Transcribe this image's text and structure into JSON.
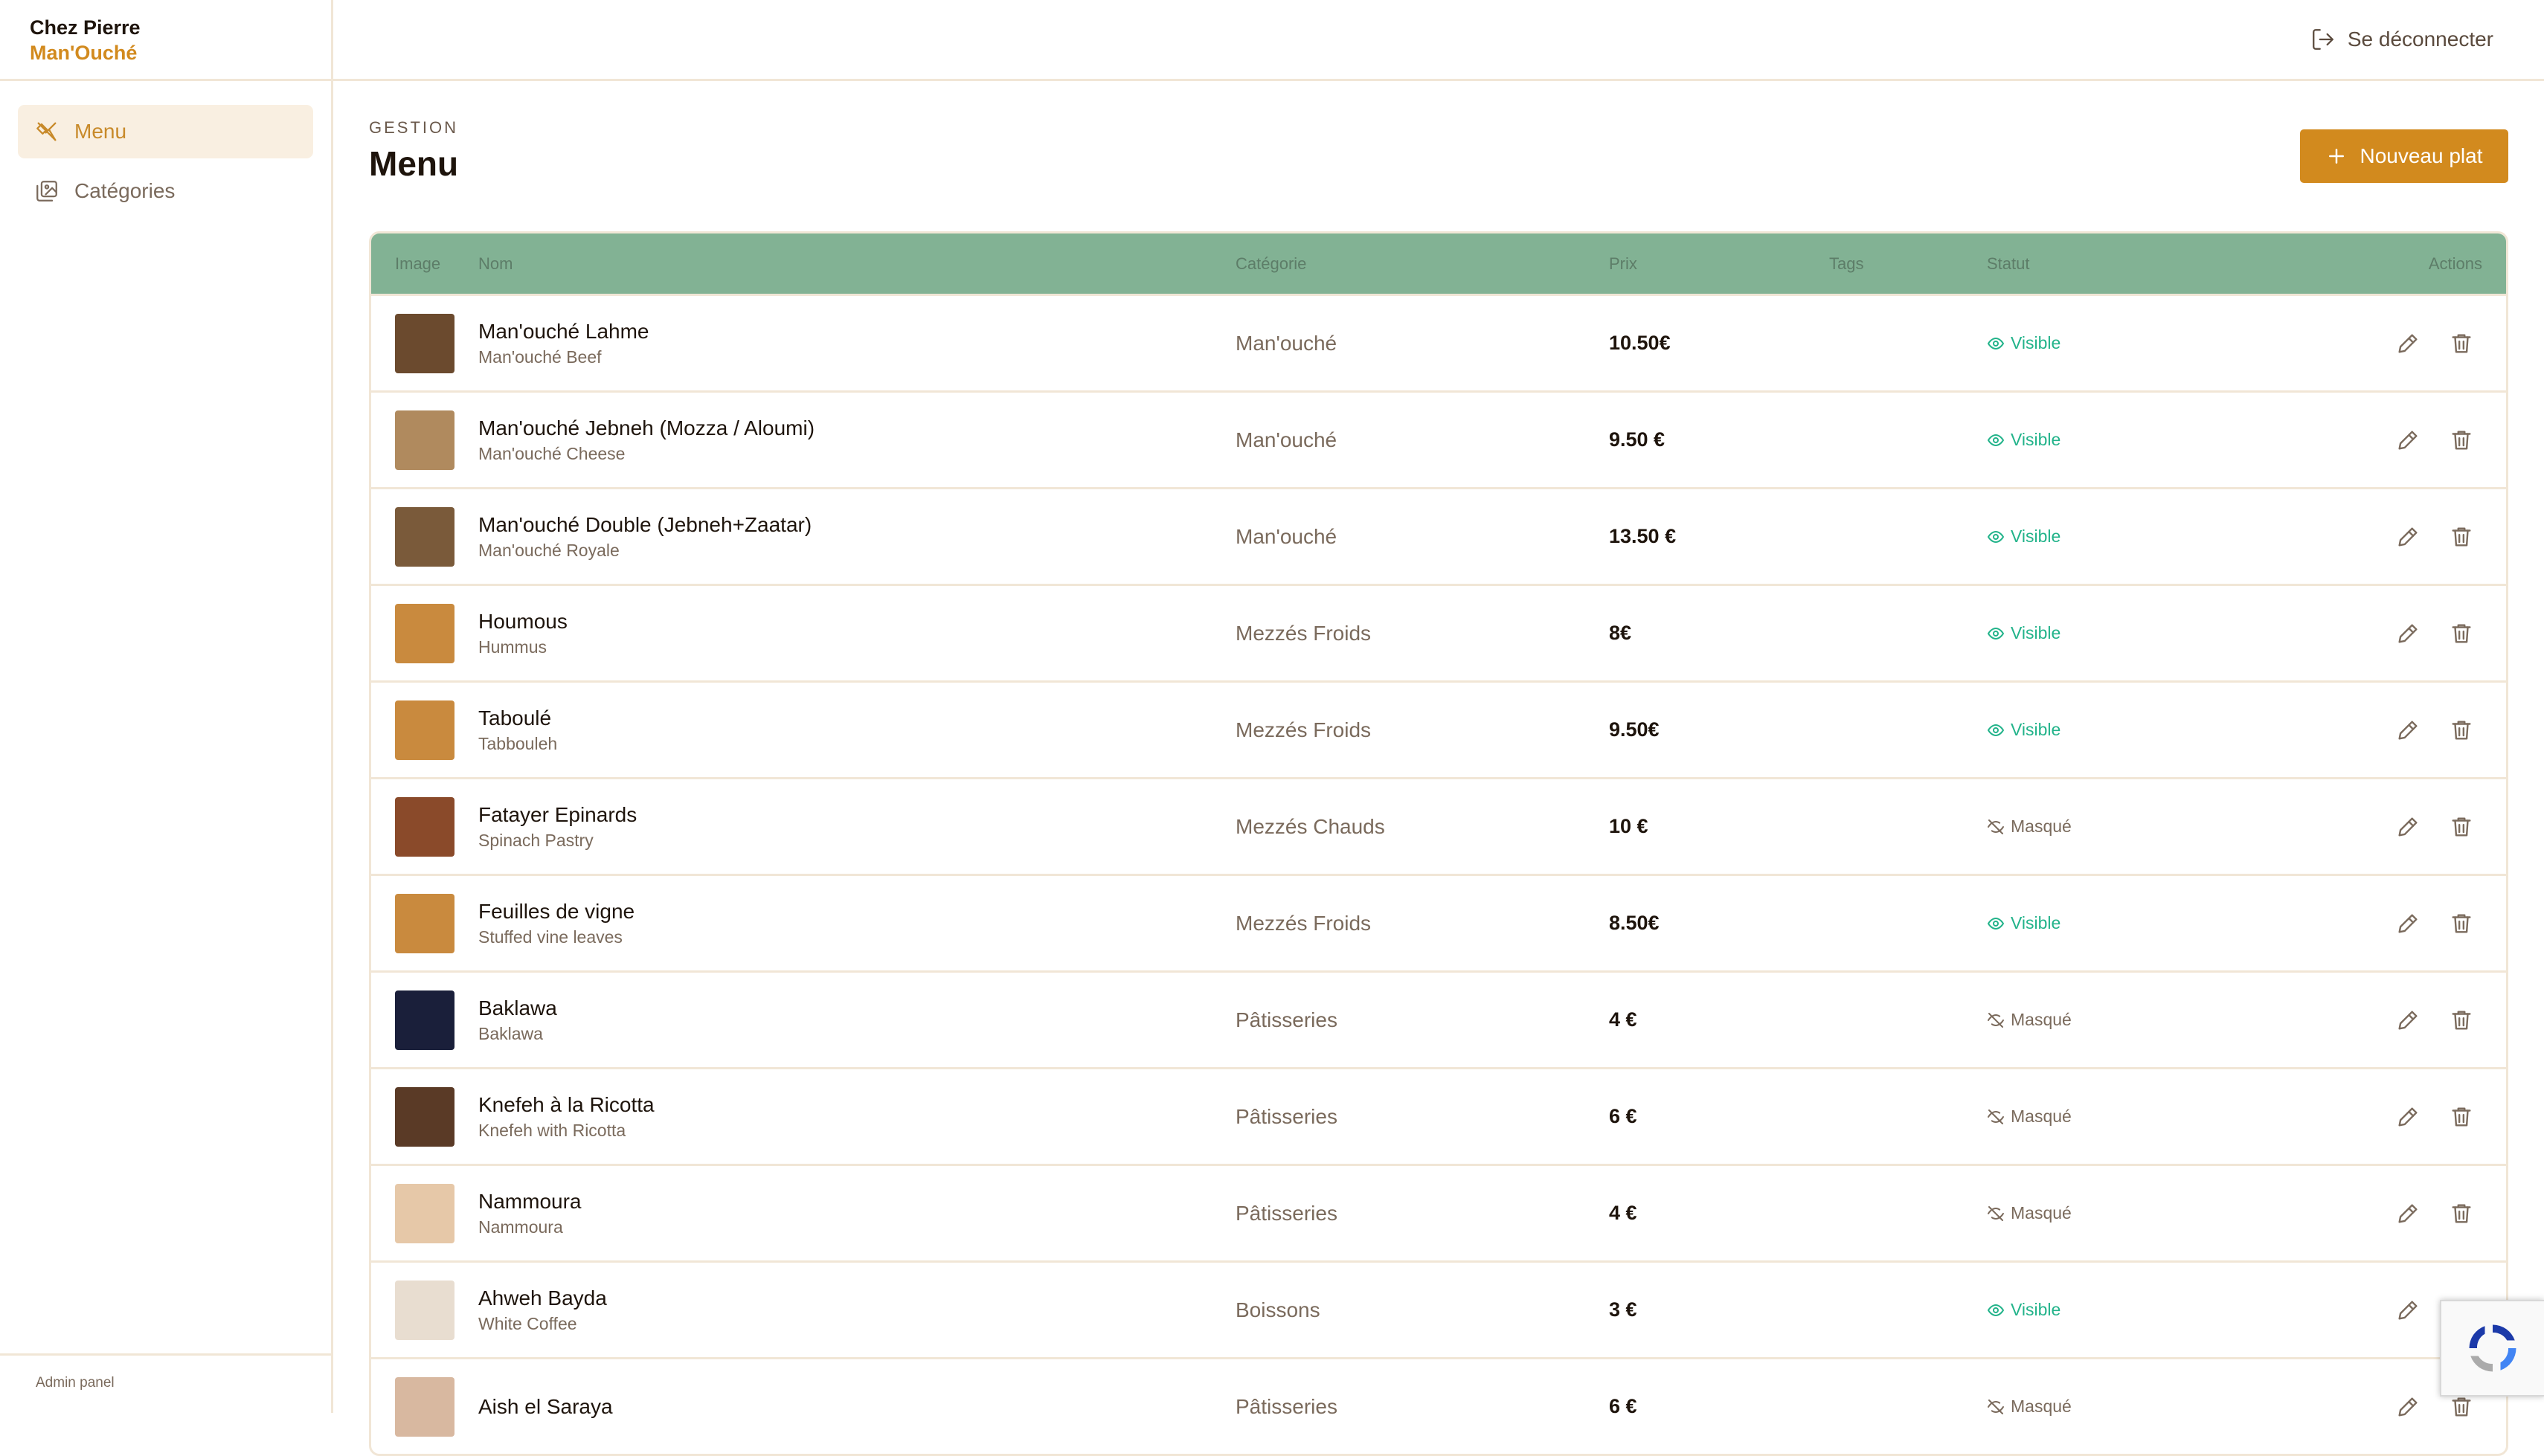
{
  "brand": {
    "line1": "Chez Pierre",
    "line2": "Man'Ouché"
  },
  "sidebar": {
    "items": [
      {
        "label": "Menu",
        "icon": "utensils-icon",
        "active": true
      },
      {
        "label": "Catégories",
        "icon": "gallery-icon",
        "active": false
      }
    ],
    "footer": "Admin panel"
  },
  "topbar": {
    "logout_label": "Se déconnecter"
  },
  "page": {
    "eyebrow": "GESTION",
    "title": "Menu",
    "new_button_label": "Nouveau plat"
  },
  "table": {
    "headers": {
      "image": "Image",
      "name": "Nom",
      "category": "Catégorie",
      "price": "Prix",
      "tags": "Tags",
      "status": "Statut",
      "actions": "Actions"
    },
    "rows": [
      {
        "name": "Man'ouché Lahme",
        "subtitle": "Man'ouché Beef",
        "category": "Man'ouché",
        "price": "10.50€",
        "status": "Visible",
        "visible": true,
        "thumb_color": "#6b4a2e"
      },
      {
        "name": "Man'ouché Jebneh (Mozza / Aloumi)",
        "subtitle": "Man'ouché Cheese",
        "category": "Man'ouché",
        "price": "9.50 €",
        "status": "Visible",
        "visible": true,
        "thumb_color": "#b08a5e"
      },
      {
        "name": "Man'ouché Double (Jebneh+Zaatar)",
        "subtitle": "Man'ouché Royale",
        "category": "Man'ouché",
        "price": "13.50 €",
        "status": "Visible",
        "visible": true,
        "thumb_color": "#7a5a3a"
      },
      {
        "name": "Houmous",
        "subtitle": "Hummus",
        "category": "Mezzés Froids",
        "price": "8€",
        "status": "Visible",
        "visible": true,
        "thumb_color": "#c98a3e"
      },
      {
        "name": "Taboulé",
        "subtitle": "Tabbouleh",
        "category": "Mezzés Froids",
        "price": "9.50€",
        "status": "Visible",
        "visible": true,
        "thumb_color": "#c98a3e"
      },
      {
        "name": "Fatayer Epinards",
        "subtitle": "Spinach Pastry",
        "category": "Mezzés Chauds",
        "price": "10 €",
        "status": "Masqué",
        "visible": false,
        "thumb_color": "#8a4a2a"
      },
      {
        "name": "Feuilles de vigne",
        "subtitle": "Stuffed vine leaves",
        "category": "Mezzés Froids",
        "price": "8.50€",
        "status": "Visible",
        "visible": true,
        "thumb_color": "#c98a3e"
      },
      {
        "name": "Baklawa",
        "subtitle": "Baklawa",
        "category": "Pâtisseries",
        "price": "4 €",
        "status": "Masqué",
        "visible": false,
        "thumb_color": "#1a1f3a"
      },
      {
        "name": "Knefeh à la Ricotta",
        "subtitle": "Knefeh with Ricotta",
        "category": "Pâtisseries",
        "price": "6 €",
        "status": "Masqué",
        "visible": false,
        "thumb_color": "#5a3a26"
      },
      {
        "name": "Nammoura",
        "subtitle": "Nammoura",
        "category": "Pâtisseries",
        "price": "4 €",
        "status": "Masqué",
        "visible": false,
        "thumb_color": "#e6c8a8"
      },
      {
        "name": "Ahweh Bayda",
        "subtitle": "White Coffee",
        "category": "Boissons",
        "price": "3 €",
        "status": "Visible",
        "visible": true,
        "thumb_color": "#e8ddd0"
      },
      {
        "name": "Aish el Saraya",
        "subtitle": "",
        "category": "Pâtisseries",
        "price": "6 €",
        "status": "Masqué",
        "visible": false,
        "thumb_color": "#d8b8a0"
      }
    ]
  },
  "colors": {
    "accent": "#d28a1e",
    "header_green": "#82b294",
    "visible_green": "#22b38a",
    "border": "#f1e6d6"
  }
}
